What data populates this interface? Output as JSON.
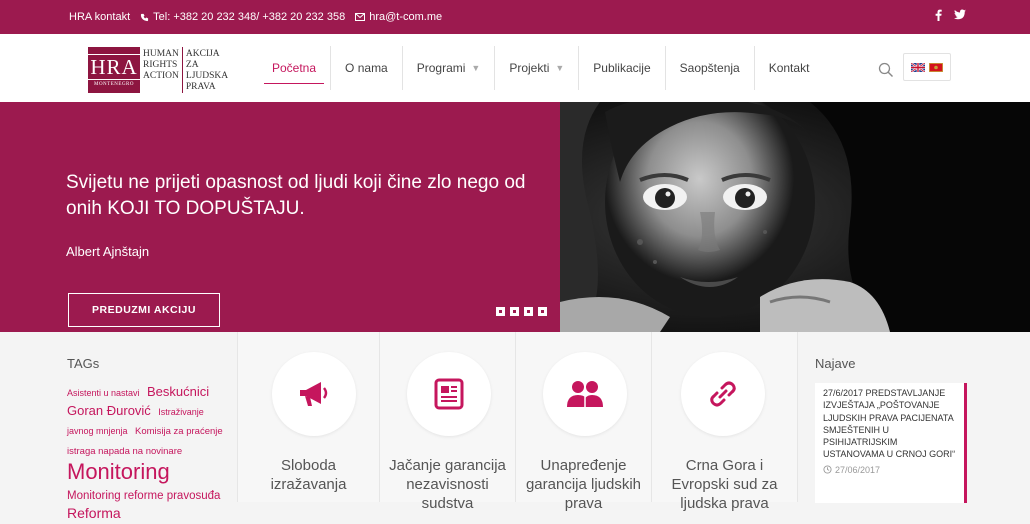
{
  "topbar": {
    "contact_label": "HRA kontakt",
    "phone": "Tel: +382 20 232 348/ +382 20 232 358",
    "email": "hra@t-com.me",
    "social": [
      "facebook-icon",
      "twitter-icon"
    ]
  },
  "logo": {
    "mark_big": "HRA",
    "mark_small": "MONTENEGRO",
    "col1": [
      "HUMAN",
      "RIGHTS",
      "ACTION"
    ],
    "col2": [
      "AKCIJA ZA",
      "LJUDSKA",
      "PRAVA"
    ]
  },
  "nav": {
    "items": [
      {
        "label": "Početna",
        "active": true,
        "dropdown": false
      },
      {
        "label": "O nama",
        "active": false,
        "dropdown": false
      },
      {
        "label": "Programi",
        "active": false,
        "dropdown": true
      },
      {
        "label": "Projekti",
        "active": false,
        "dropdown": true
      },
      {
        "label": "Publikacije",
        "active": false,
        "dropdown": false
      },
      {
        "label": "Saopštenja",
        "active": false,
        "dropdown": false
      },
      {
        "label": "Kontakt",
        "active": false,
        "dropdown": false
      }
    ]
  },
  "hero": {
    "quote": "Svijetu ne prijeti opasnost od ljudi koji čine zlo nego od onih KOJI TO DOPUŠTAJU.",
    "author": "Albert Ajnštajn",
    "cta": "PREDUZMI AKCIJU",
    "slides": 4
  },
  "tags": {
    "title": "TAGs",
    "items": [
      {
        "text": "Asistenti u nastavi",
        "size": 9
      },
      {
        "text": "Beskućnici",
        "size": 13
      },
      {
        "text": "Goran Đurović",
        "size": 13
      },
      {
        "text": "Istraživanje javnog mnjenja",
        "size": 9
      },
      {
        "text": "Komisija za praćenje istraga napada na novinare",
        "size": 9.5
      },
      {
        "text": "Monitoring",
        "size": 22
      },
      {
        "text": "Monitoring reforme pravosuđa",
        "size": 11.5
      },
      {
        "text": "Reforma",
        "size": 14
      }
    ]
  },
  "features": [
    {
      "icon": "megaphone-icon",
      "title": "Sloboda izražavanja"
    },
    {
      "icon": "document-icon",
      "title": "Jačanje garancija nezavisnosti sudstva"
    },
    {
      "icon": "users-icon",
      "title": "Unapređenje garancija ljudskih prava"
    },
    {
      "icon": "link-icon",
      "title": "Crna Gora i Evropski sud za ljudska prava"
    }
  ],
  "najave": {
    "title": "Najave",
    "post_text": "27/6/2017 PREDSTAVLJANJE IZVJEŠTAJA „POŠTOVANJE LJUDSKIH PRAVA PACIJENATA SMJEŠTENIH U PSIHIJATRIJSKIM USTANOVAMA U CRNOJ GORI“",
    "post_date": "27/06/2017"
  },
  "colors": {
    "brand": "#9c1a4f",
    "accent": "#c5165d"
  }
}
